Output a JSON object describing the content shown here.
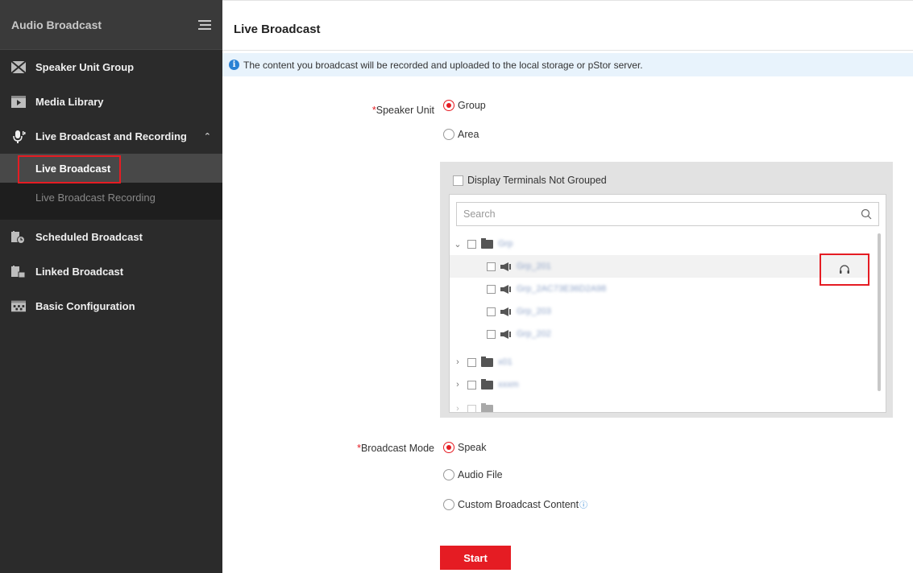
{
  "sidebar": {
    "title": "Audio Broadcast",
    "items": [
      {
        "label": "Speaker Unit Group",
        "icon": "speaker-group-icon"
      },
      {
        "label": "Media Library",
        "icon": "media-library-icon"
      },
      {
        "label": "Live Broadcast and Recording",
        "icon": "microphone-icon"
      },
      {
        "label": "Scheduled Broadcast",
        "icon": "scheduled-broadcast-icon"
      },
      {
        "label": "Linked Broadcast",
        "icon": "linked-broadcast-icon"
      },
      {
        "label": "Basic Configuration",
        "icon": "basic-configuration-icon"
      }
    ],
    "sub_items": [
      {
        "label": "Live Broadcast",
        "active": true
      },
      {
        "label": "Live Broadcast Recording",
        "active": false
      }
    ]
  },
  "main": {
    "title": "Live Broadcast",
    "notice": "The content you broadcast will be recorded and uploaded to the local storage or pStor server.",
    "speaker_unit": {
      "label": "Speaker Unit",
      "options": [
        {
          "label": "Group",
          "checked": true
        },
        {
          "label": "Area",
          "checked": false
        }
      ]
    },
    "panel": {
      "display_not_grouped": "Display Terminals Not Grouped",
      "search_placeholder": "Search",
      "tree": [
        {
          "label": "Grp",
          "type": "folder",
          "expanded": true
        },
        {
          "label": "Grp_201",
          "type": "speaker"
        },
        {
          "label": "Grp_2AC73E36D2A98",
          "type": "speaker"
        },
        {
          "label": "Grp_203",
          "type": "speaker"
        },
        {
          "label": "Grp_202",
          "type": "speaker"
        },
        {
          "label": "x01",
          "type": "folder",
          "expanded": false
        },
        {
          "label": "xxxm",
          "type": "folder",
          "expanded": false
        }
      ]
    },
    "broadcast_mode": {
      "label": "Broadcast Mode",
      "options": [
        {
          "label": "Speak",
          "checked": true
        },
        {
          "label": "Audio File",
          "checked": false
        },
        {
          "label": "Custom Broadcast Content",
          "checked": false
        }
      ]
    },
    "start_label": "Start",
    "accent_color": "#e51c23",
    "info_color": "#2a82d4"
  }
}
